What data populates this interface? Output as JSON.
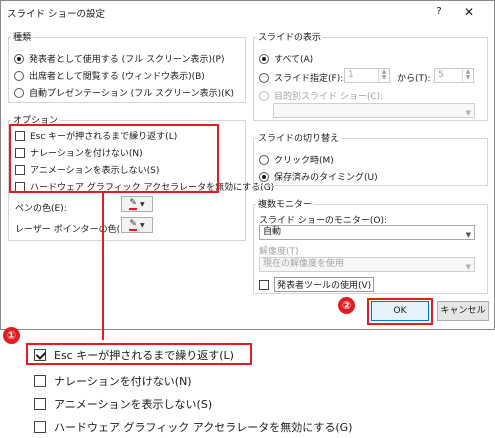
{
  "window": {
    "title": "スライド ショーの設定",
    "help": "?",
    "close": "✕"
  },
  "kind": {
    "label": "種類",
    "options": [
      {
        "label": "発表者として使用する (フル スクリーン表示)(P)",
        "selected": true
      },
      {
        "label": "出席者として閲覧する (ウィンドウ表示)(B)",
        "selected": false
      },
      {
        "label": "自動プレゼンテーション (フル スクリーン表示)(K)",
        "selected": false
      }
    ]
  },
  "options": {
    "label": "オプション",
    "checks": [
      {
        "label": "Esc キーが押されるまで繰り返す(L)",
        "checked": false
      },
      {
        "label": "ナレーションを付けない(N)",
        "checked": false
      },
      {
        "label": "アニメーションを表示しない(S)",
        "checked": false
      },
      {
        "label": "ハードウェア グラフィック アクセラレータを無効にする(G)",
        "checked": false
      }
    ],
    "pen_color_label": "ペンの色(E):",
    "laser_color_label": "レーザー ポインターの色(R):",
    "pen_color": "#e02020",
    "laser_color": "#e02020"
  },
  "display": {
    "label": "スライドの表示",
    "all": "すべて(A)",
    "range": "スライド指定(F):",
    "from": "1",
    "to_label": "から(T):",
    "to": "5",
    "custom": "目的別スライド ショー(C):",
    "custom_value": ""
  },
  "advance": {
    "label": "スライドの切り替え",
    "options": [
      {
        "label": "クリック時(M)",
        "selected": false
      },
      {
        "label": "保存済みのタイミング(U)",
        "selected": true
      }
    ]
  },
  "monitor": {
    "label": "複数モニター",
    "monitor_label": "スライド ショーのモニター(O):",
    "monitor_value": "自動",
    "resolution_label": "解像度(T)",
    "resolution_value": "現在の解像度を使用",
    "presenter_view": "発表者ツールの使用(V)",
    "presenter_view_checked": false
  },
  "buttons": {
    "ok": "OK",
    "cancel": "キャンセル"
  },
  "callouts": {
    "one": "①",
    "two": "②"
  },
  "zoom": {
    "checks": [
      {
        "label": "Esc キーが押されるまで繰り返す(L)",
        "checked": true
      },
      {
        "label": "ナレーションを付けない(N)",
        "checked": false
      },
      {
        "label": "アニメーションを表示しない(S)",
        "checked": false
      },
      {
        "label": "ハードウェア グラフィック アクセラレータを無効にする(G)",
        "checked": false
      }
    ]
  },
  "accent": "#e31b23"
}
